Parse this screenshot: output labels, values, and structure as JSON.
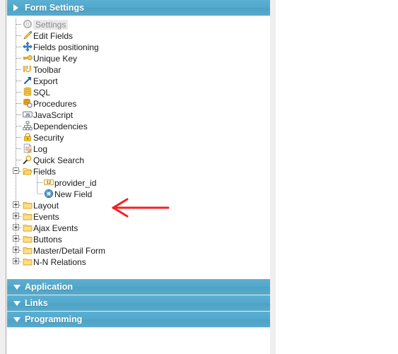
{
  "accordion": {
    "sections": [
      {
        "id": "form-settings",
        "label": "Form Settings",
        "expanded": true,
        "arrow_icon": "triangle-right-icon"
      },
      {
        "id": "application",
        "label": "Application",
        "expanded": false,
        "arrow_icon": "triangle-down-icon"
      },
      {
        "id": "links",
        "label": "Links",
        "expanded": false,
        "arrow_icon": "triangle-down-icon"
      },
      {
        "id": "programming",
        "label": "Programming",
        "expanded": false,
        "arrow_icon": "triangle-down-icon"
      }
    ]
  },
  "tree": {
    "nodes": [
      {
        "label": "Settings",
        "icon": "gear-icon",
        "state": "selected",
        "level": 1,
        "expander": "none"
      },
      {
        "label": "Edit Fields",
        "icon": "pencil-icon",
        "state": "normal",
        "level": 1,
        "expander": "none"
      },
      {
        "label": "Fields positioning",
        "icon": "move-arrows-icon",
        "state": "normal",
        "level": 1,
        "expander": "none"
      },
      {
        "label": "Unique Key",
        "icon": "key-icon",
        "state": "normal",
        "level": 1,
        "expander": "none"
      },
      {
        "label": "Toolbar",
        "icon": "toolbar-icon",
        "state": "normal",
        "level": 1,
        "expander": "none"
      },
      {
        "label": "Export",
        "icon": "export-arrow-icon",
        "state": "normal",
        "level": 1,
        "expander": "none"
      },
      {
        "label": "SQL",
        "icon": "database-icon",
        "state": "normal",
        "level": 1,
        "expander": "none"
      },
      {
        "label": "Procedures",
        "icon": "procedures-icon",
        "state": "normal",
        "level": 1,
        "expander": "none"
      },
      {
        "label": "JavaScript",
        "icon": "javascript-icon",
        "state": "normal",
        "level": 1,
        "expander": "none"
      },
      {
        "label": "Dependencies",
        "icon": "dependencies-icon",
        "state": "normal",
        "level": 1,
        "expander": "none"
      },
      {
        "label": "Security",
        "icon": "padlock-icon",
        "state": "normal",
        "level": 1,
        "expander": "none"
      },
      {
        "label": "Log",
        "icon": "log-document-icon",
        "state": "normal",
        "level": 1,
        "expander": "none"
      },
      {
        "label": "Quick Search",
        "icon": "magnifier-icon",
        "state": "normal",
        "level": 1,
        "expander": "none"
      },
      {
        "label": "Fields",
        "icon": "folder-open-icon",
        "state": "normal",
        "level": 1,
        "expander": "minus"
      },
      {
        "label": "provider_id",
        "icon": "number-field-icon",
        "state": "normal",
        "level": 2,
        "expander": "none"
      },
      {
        "label": "New Field",
        "icon": "new-field-icon",
        "state": "normal",
        "level": 2,
        "expander": "none"
      },
      {
        "label": "Layout",
        "icon": "folder-icon",
        "state": "normal",
        "level": 1,
        "expander": "plus"
      },
      {
        "label": "Events",
        "icon": "folder-icon",
        "state": "normal",
        "level": 1,
        "expander": "plus"
      },
      {
        "label": "Ajax Events",
        "icon": "folder-icon",
        "state": "normal",
        "level": 1,
        "expander": "plus"
      },
      {
        "label": "Buttons",
        "icon": "folder-icon",
        "state": "normal",
        "level": 1,
        "expander": "plus"
      },
      {
        "label": "Master/Detail Form",
        "icon": "folder-icon",
        "state": "normal",
        "level": 1,
        "expander": "plus"
      },
      {
        "label": "N-N Relations",
        "icon": "folder-icon",
        "state": "normal",
        "level": 1,
        "expander": "plus"
      }
    ]
  },
  "annotation": {
    "type": "arrow",
    "direction": "left",
    "color": "#f52020",
    "points_at": "New Field"
  },
  "colors": {
    "accent": "#52a8cb",
    "header_text": "#ffffff",
    "tree_text": "#1a1a1a",
    "selected_text": "#8b8b8b",
    "selected_bg": "#e9e9e9",
    "annotation": "#f52020",
    "gutter": "#efefef"
  }
}
